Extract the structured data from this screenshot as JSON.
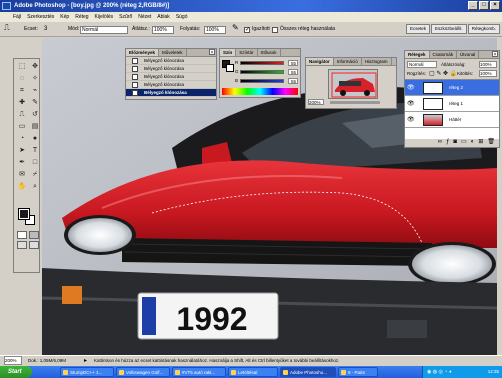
{
  "window": {
    "title": "Adobe Photoshop - [boy.jpg @ 200% (réteg 2,RGB/8#)]"
  },
  "menu": [
    "Fájl",
    "Szerkesztés",
    "Kép",
    "Réteg",
    "Kijelölés",
    "Szűrő",
    "Nézet",
    "Ablak",
    "Súgó"
  ],
  "options": {
    "ecset_label": "Ecset:",
    "ecset_size": "3",
    "mod_label": "Mód:",
    "mod_value": "Normál",
    "atlatszo_label": "Átlátsz.:",
    "atlatszo_value": "100%",
    "folyatas_label": "Folyatás:",
    "folyatas_value": "100%",
    "igazitott_label": "Igazított",
    "osszes_label": "Összes réteg használata",
    "tabs": [
      "Ecsetek",
      "Eszközbeállít.",
      "Rétegkomb."
    ]
  },
  "history_panel": {
    "tabs": [
      "Előzmények",
      "Műveletek"
    ],
    "items": [
      {
        "label": "Bélyegző klónozása"
      },
      {
        "label": "Bélyegző klónozása"
      },
      {
        "label": "Bélyegző klónozása"
      },
      {
        "label": "Bélyegző klónozása"
      },
      {
        "label": "Bélyegző klónozása"
      }
    ]
  },
  "color_panel": {
    "tabs": [
      "Szín",
      "Színtár",
      "Stílusok"
    ],
    "sliders": [
      {
        "label": "R",
        "value": "55",
        "color": "#e02020"
      },
      {
        "label": "G",
        "value": "55",
        "color": "#20c020"
      },
      {
        "label": "B",
        "value": "55",
        "color": "#2040e0"
      }
    ]
  },
  "navigator_panel": {
    "tabs": [
      "Navigátor",
      "Információ",
      "Hisztogram"
    ],
    "zoom": "200%"
  },
  "layers_panel": {
    "tabs": [
      "Rétegek",
      "Csatornák",
      "Útvonal"
    ],
    "blend_mode": "Normál",
    "opacity_label": "Átlátszóság:",
    "opacity": "100%",
    "lock_label": "Rögzítés:",
    "fill_label": "Kitöltés:",
    "fill": "100%",
    "layers": [
      {
        "name": "réteg 2",
        "selected": true
      },
      {
        "name": "réteg 1",
        "selected": false
      },
      {
        "name": "Háttér",
        "selected": false
      }
    ]
  },
  "canvas": {
    "plate": "1992",
    "car_color": "#d8202a"
  },
  "status": {
    "zoom": "200%",
    "doc": "Dok.: 1,05M/6,09M",
    "hint": "Kattintson és húzza az ecset kattintásnak használatához. Használja a Shift, Alt és Ctrl billentyűket a további beállításokhoz."
  },
  "taskbar": {
    "start": "Start",
    "tasks": [
      {
        "label": "StumpDC++ 1...",
        "active": false
      },
      {
        "label": "Volkswagen Golf...",
        "active": false
      },
      {
        "label": "#VT5 autó rakt...",
        "active": false
      },
      {
        "label": "LetöltésaÍ",
        "active": false
      },
      {
        "label": "Adobe Photosho...",
        "active": true
      },
      {
        "label": "9 - Paint",
        "active": false
      }
    ],
    "clock": "12:35"
  }
}
